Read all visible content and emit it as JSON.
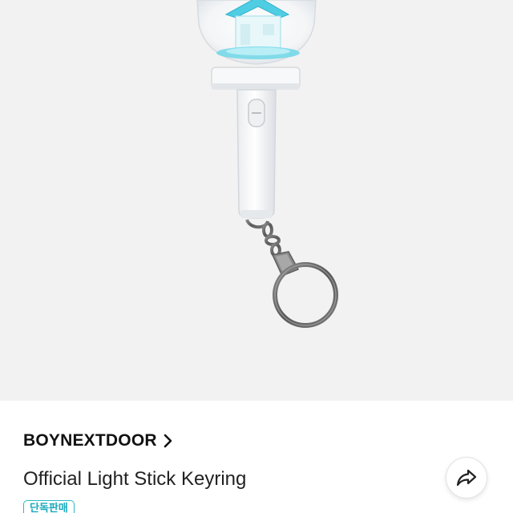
{
  "product": {
    "brand": "BOYNEXTDOOR",
    "title": "Official Light Stick Keyring",
    "badge": "단독판매",
    "image_alt": "Light stick keyring product photo"
  },
  "icons": {
    "brand_chevron": "chevron-right-icon",
    "share": "share-icon"
  },
  "colors": {
    "image_background": "#f2f2f2",
    "badge_accent": "#2bb7c9",
    "light_blue": "#5cd3e6",
    "text_primary": "#111111"
  }
}
